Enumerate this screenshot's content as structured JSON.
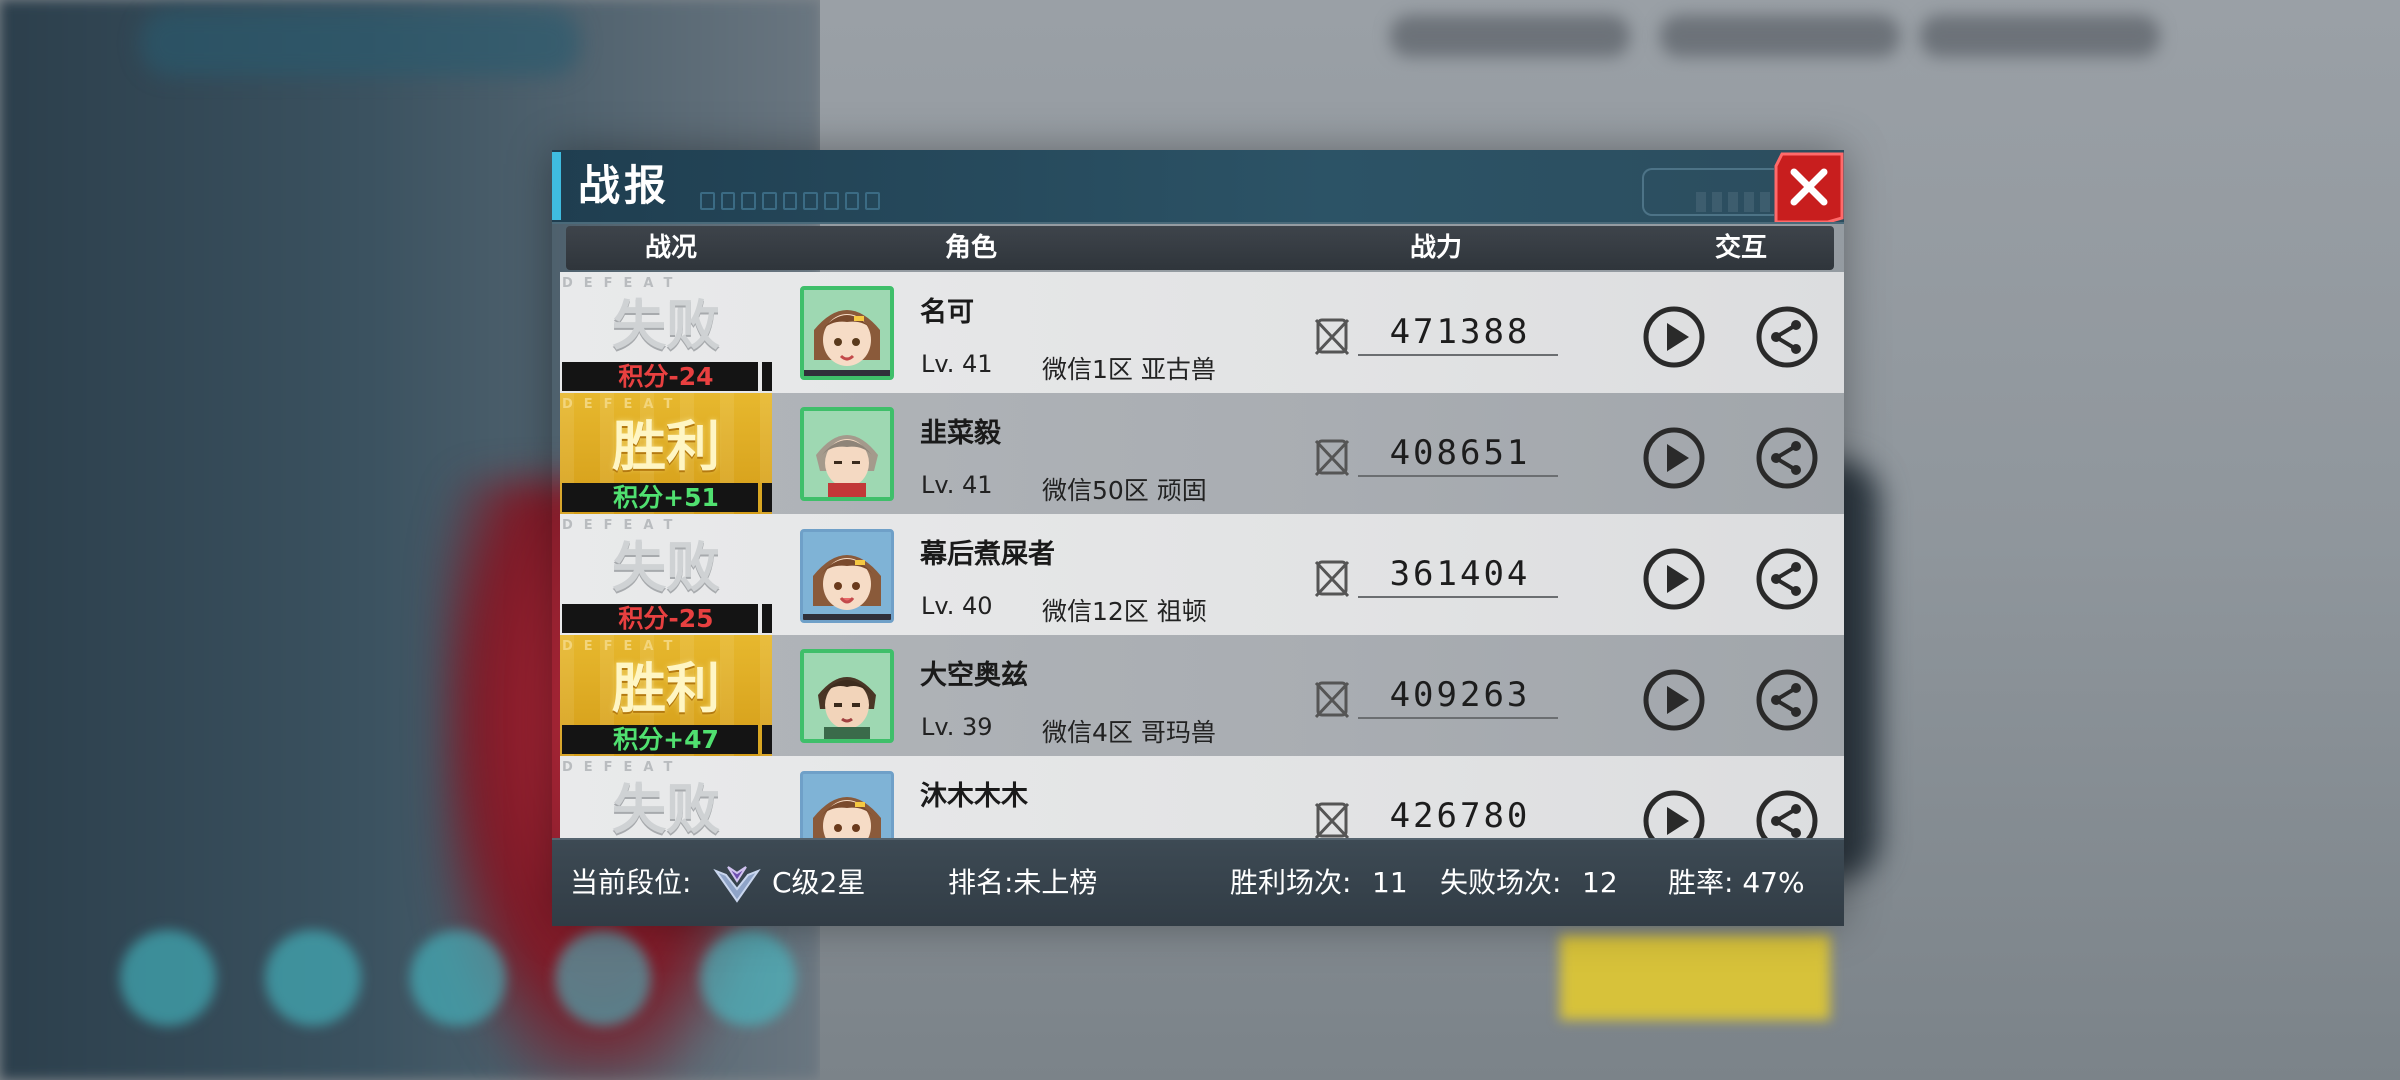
{
  "dialog": {
    "title": "战报",
    "close_icon": "close-icon"
  },
  "table": {
    "headers": [
      "战况",
      "角色",
      "战力",
      "交互"
    ]
  },
  "records": [
    {
      "result": "失败",
      "tag": "DEFEAT",
      "score": "积分-24",
      "name": "名可",
      "level": "Lv. 41",
      "server": "微信1区 亚古兽",
      "power": "471388",
      "avatar": "green",
      "win": false
    },
    {
      "result": "胜利",
      "tag": "DEFEAT",
      "score": "积分+51",
      "name": "韭菜毅",
      "level": "Lv. 41",
      "server": "微信50区 顽固",
      "power": "408651",
      "avatar": "green",
      "win": true
    },
    {
      "result": "失败",
      "tag": "DEFEAT",
      "score": "积分-25",
      "name": "幕后煮屎者",
      "level": "Lv. 40",
      "server": "微信12区 祖顿",
      "power": "361404",
      "avatar": "blue",
      "win": false
    },
    {
      "result": "胜利",
      "tag": "DEFEAT",
      "score": "积分+47",
      "name": "大空奥兹",
      "level": "Lv. 39",
      "server": "微信4区 哥玛兽",
      "power": "409263",
      "avatar": "green",
      "win": true
    },
    {
      "result": "失败",
      "tag": "DEFEAT",
      "score": "",
      "name": "沐木木木",
      "level": "",
      "server": "",
      "power": "426780",
      "avatar": "blue",
      "win": false
    }
  ],
  "footer": {
    "rank_label": "当前段位:",
    "rank_value": "C级2星",
    "ranking": "排名:未上榜",
    "wins_label": "胜利场次:",
    "wins_value": "11",
    "losses_label": "失败场次:",
    "losses_value": "12",
    "winrate": "胜率: 47%"
  },
  "colors": {
    "win_gold": "#d9a51c",
    "lose_gray": "#e5e6e7",
    "score_red": "#e84040",
    "score_green": "#50e070",
    "close_red": "#d82a2a",
    "header_blue": "#2c5366"
  }
}
